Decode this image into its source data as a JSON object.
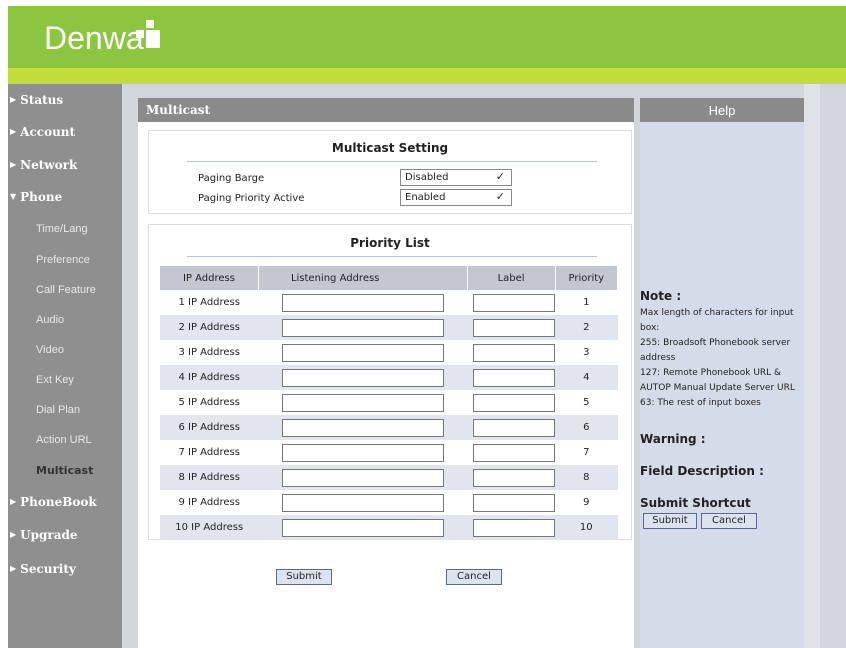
{
  "brand": {
    "logo_text": "Denwa"
  },
  "sidebar": {
    "items": [
      {
        "label": "Status"
      },
      {
        "label": "Account"
      },
      {
        "label": "Network"
      },
      {
        "label": "Phone"
      },
      {
        "label": "PhoneBook"
      },
      {
        "label": "Upgrade"
      },
      {
        "label": "Security"
      }
    ],
    "phone_sub": [
      {
        "label": "Time/Lang"
      },
      {
        "label": "Preference"
      },
      {
        "label": "Call Feature"
      },
      {
        "label": "Audio"
      },
      {
        "label": "Video"
      },
      {
        "label": "Ext Key"
      },
      {
        "label": "Dial Plan"
      },
      {
        "label": "Action URL"
      },
      {
        "label": "Multicast"
      }
    ]
  },
  "main": {
    "title": "Multicast",
    "multicast_setting": {
      "title": "Multicast Setting",
      "paging_barge_label": "Paging Barge",
      "paging_barge_value": "Disabled",
      "paging_priority_label": "Paging Priority Active",
      "paging_priority_value": "Enabled"
    },
    "priority_list": {
      "title": "Priority List",
      "headers": [
        "IP Address",
        "Listening Address",
        "Label",
        "Priority"
      ],
      "rows": [
        {
          "name": "1 IP Address",
          "priority": "1"
        },
        {
          "name": "2 IP Address",
          "priority": "2"
        },
        {
          "name": "3 IP Address",
          "priority": "3"
        },
        {
          "name": "4 IP Address",
          "priority": "4"
        },
        {
          "name": "5 IP Address",
          "priority": "5"
        },
        {
          "name": "6 IP Address",
          "priority": "6"
        },
        {
          "name": "7 IP Address",
          "priority": "7"
        },
        {
          "name": "8 IP Address",
          "priority": "8"
        },
        {
          "name": "9 IP Address",
          "priority": "9"
        },
        {
          "name": "10 IP Address",
          "priority": "10"
        }
      ]
    },
    "submit_label": "Submit",
    "cancel_label": "Cancel"
  },
  "help": {
    "title": "Help",
    "note_heading": "Note :",
    "note_lines": [
      "Max length of characters for input box:",
      "255: Broadsoft Phonebook server address",
      "127: Remote Phonebook URL & AUTOP Manual Update Server URL",
      "63: The rest of input boxes"
    ],
    "warning_heading": "Warning :",
    "field_heading": "Field Description :",
    "shortcut_heading": "Submit Shortcut",
    "submit_label": "Submit",
    "cancel_label": "Cancel"
  },
  "colors": {
    "brand_green": "#8cc63f",
    "accent_lime": "#c2dc3a",
    "sidebar_gray": "#8f8f8f"
  }
}
